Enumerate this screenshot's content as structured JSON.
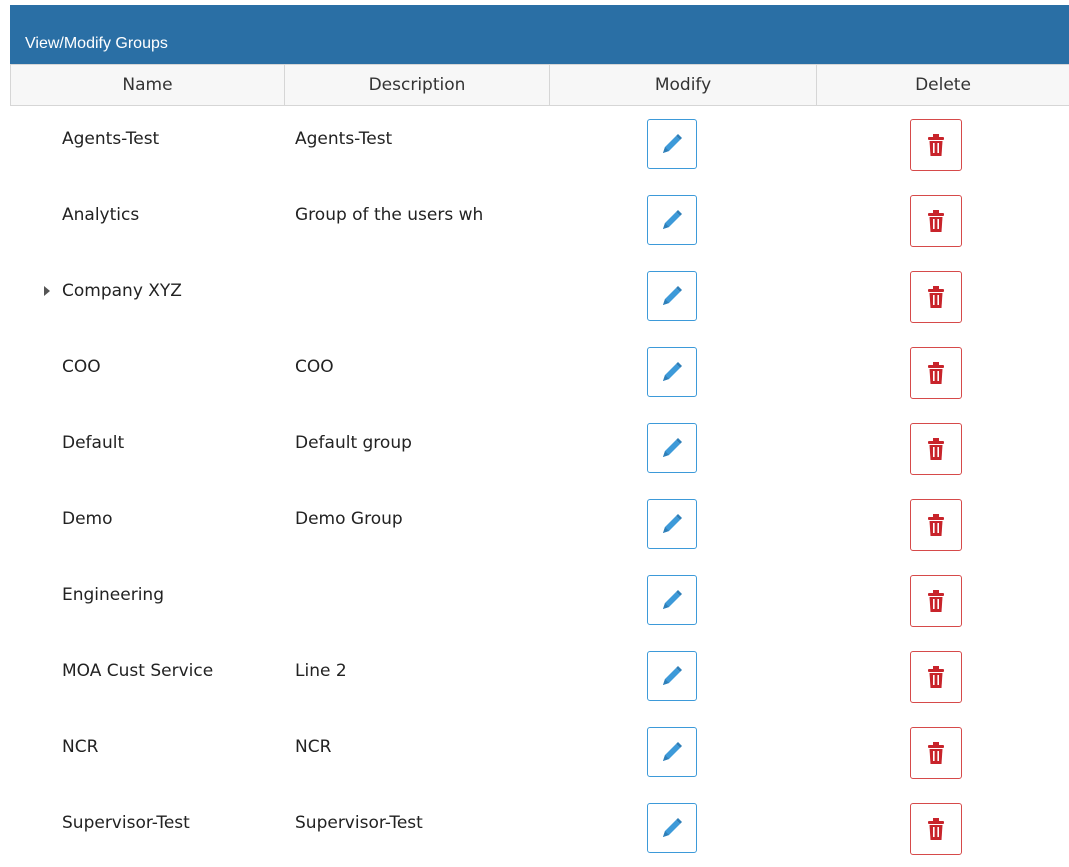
{
  "panel": {
    "title": "View/Modify Groups"
  },
  "columns": {
    "name": "Name",
    "description": "Description",
    "modify": "Modify",
    "delete": "Delete"
  },
  "rows": [
    {
      "name": "Agents-Test",
      "description": "Agents-Test",
      "expandable": false
    },
    {
      "name": "Analytics",
      "description": "Group of the users wh",
      "expandable": false
    },
    {
      "name": "Company XYZ",
      "description": "",
      "expandable": true
    },
    {
      "name": "COO",
      "description": "COO",
      "expandable": false
    },
    {
      "name": "Default",
      "description": "Default group",
      "expandable": false
    },
    {
      "name": "Demo",
      "description": "Demo Group",
      "expandable": false
    },
    {
      "name": "Engineering",
      "description": "",
      "expandable": false
    },
    {
      "name": "MOA Cust Service",
      "description": "Line 2",
      "expandable": false
    },
    {
      "name": "NCR",
      "description": "NCR",
      "expandable": false
    },
    {
      "name": "Supervisor-Test",
      "description": "Supervisor-Test",
      "expandable": false
    }
  ],
  "icons": {
    "edit": "pencil-icon",
    "delete": "trash-icon",
    "expander": "triangle-right-icon"
  },
  "colors": {
    "title_bar": "#2a6fa5",
    "edit_accent": "#3d9ad9",
    "delete_accent": "#d64a4a",
    "delete_fill": "#c8242b"
  }
}
